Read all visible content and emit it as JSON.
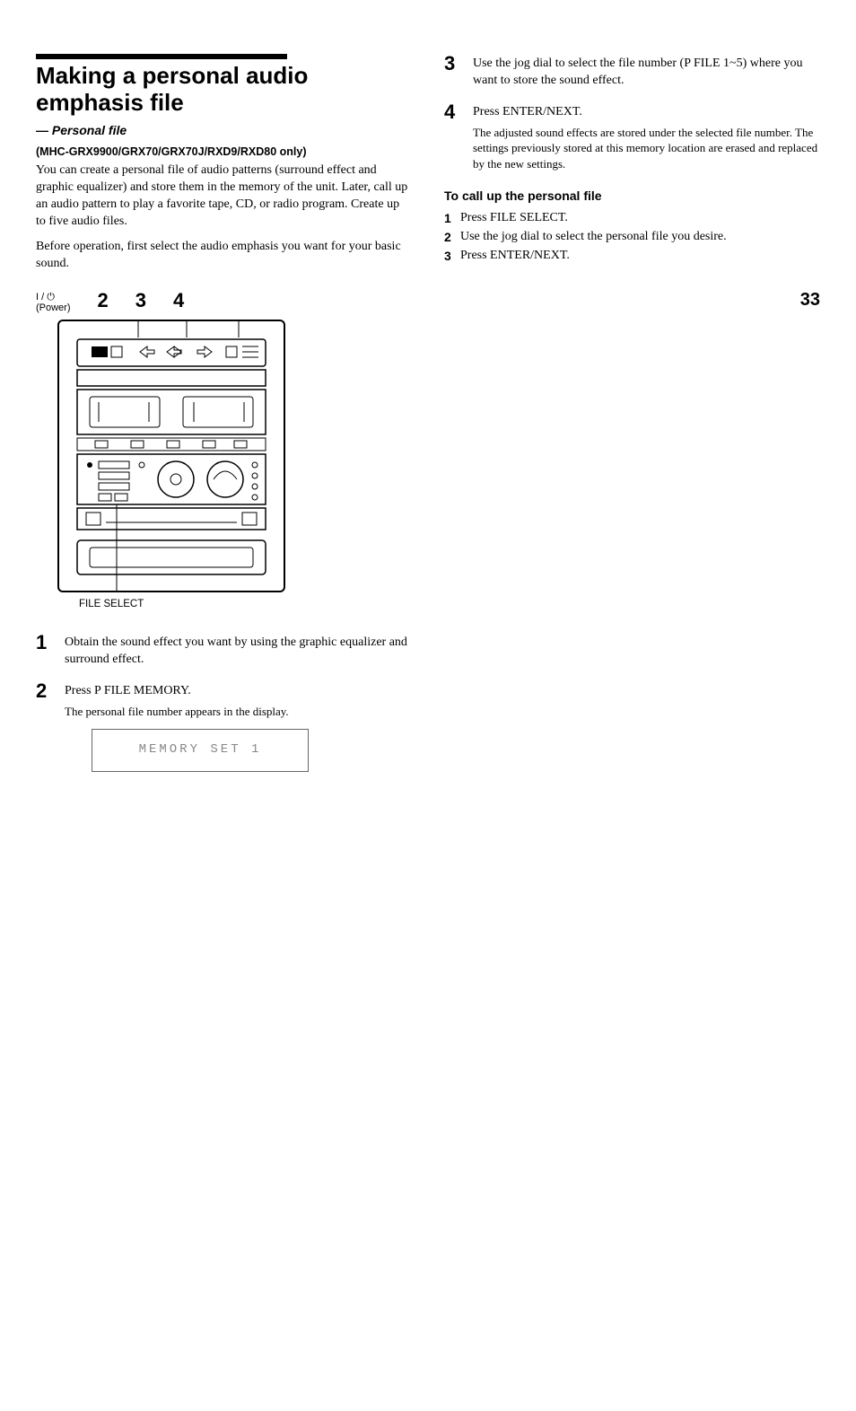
{
  "title": "Making a personal audio emphasis file",
  "subtitle": "— Personal file",
  "model_note": "(MHC-GRX9900/GRX70/GRX70J/RXD9/RXD80 only)",
  "intro1": "You can create a personal file of audio patterns (surround effect and graphic equalizer) and store them in the memory of the unit. Later, call up an audio pattern to play a favorite tape, CD, or radio program. Create up to five audio files.",
  "intro2": "Before operation, first select the audio emphasis you want for your basic sound.",
  "diagram": {
    "power_label": "I / ⏻\n(Power)",
    "n2": "2",
    "n3": "3",
    "n4": "4",
    "file_select": "FILE SELECT"
  },
  "steps_left": [
    {
      "num": "1",
      "text": "Obtain the sound effect you want by using the graphic equalizer and surround effect."
    },
    {
      "num": "2",
      "text": "Press P FILE MEMORY.",
      "sub": "The personal file number appears in the display."
    }
  ],
  "display_text": "MEMORY SET 1",
  "steps_right": [
    {
      "num": "3",
      "text": "Use the jog dial to select the file number (P FILE 1~5) where you want to store the sound effect."
    },
    {
      "num": "4",
      "text": "Press ENTER/NEXT.",
      "sub": "The adjusted sound effects are stored under the selected file number. The settings previously stored at this memory location are erased and replaced by the new settings."
    }
  ],
  "callup_head": "To call up the personal file",
  "callup_list": [
    {
      "n": "1",
      "t": "Press FILE SELECT."
    },
    {
      "n": "2",
      "t": "Use the jog dial to select the personal file you desire."
    },
    {
      "n": "3",
      "t": "Press ENTER/NEXT."
    }
  ],
  "page_number": "33"
}
